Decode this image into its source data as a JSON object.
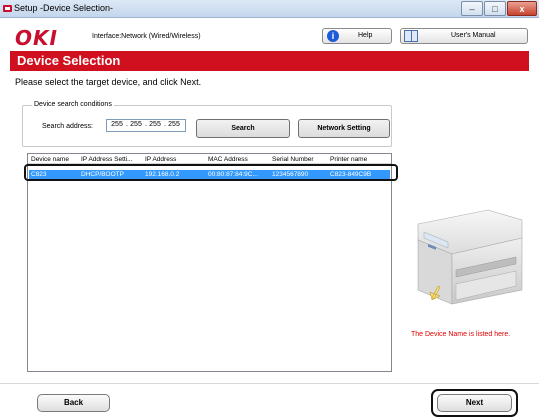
{
  "window": {
    "title": "Setup -Device Selection-",
    "close_glyph": "x",
    "minimize_glyph": "–",
    "maximize_glyph": "□"
  },
  "header": {
    "logo": "OKI",
    "interface_text": "Interface:Network (Wired/Wireless)",
    "help_label": "Help",
    "help_icon_glyph": "i",
    "manual_label": "User's Manual"
  },
  "banner": {
    "title": "Device Selection"
  },
  "instruction": "Please select the target device, and click Next.",
  "search": {
    "legend": "Device search conditions",
    "address_label": "Search address:",
    "octets": [
      "255",
      "255",
      "255",
      "255"
    ],
    "search_label": "Search",
    "network_setting_label": "Network Setting"
  },
  "device_list": {
    "columns": [
      "Device name",
      "IP Address Setti...",
      "IP Address",
      "MAC Address",
      "Serial Number",
      "Printer name"
    ],
    "rows": [
      {
        "device_name": "C823",
        "ip_setting": "DHCP/BOOTP",
        "ip_address": "192.168.0.2",
        "mac_address": "00:80:87:84:9C...",
        "serial_number": "1234567890",
        "printer_name": "C823-849C9B"
      }
    ]
  },
  "side_note": "The Device Name is listed here.",
  "footer": {
    "back_label": "Back",
    "next_label": "Next"
  },
  "colors": {
    "accent_red": "#d0101f",
    "selection_blue": "#3399ff",
    "note_red": "#e00000"
  }
}
